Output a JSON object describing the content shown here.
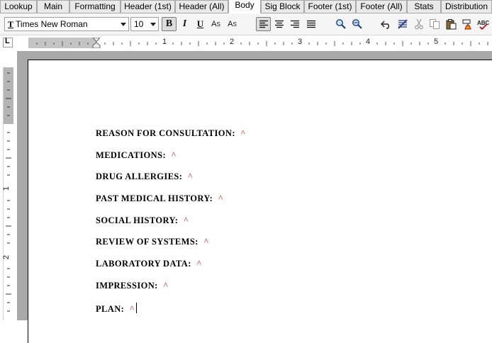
{
  "tabs": [
    {
      "label": "Lookup",
      "active": false
    },
    {
      "label": "Main",
      "active": false
    },
    {
      "label": "Formatting",
      "active": false
    },
    {
      "label": "Header (1st)",
      "active": false
    },
    {
      "label": "Header (All)",
      "active": false
    },
    {
      "label": "Body",
      "active": true
    },
    {
      "label": "Sig Block",
      "active": false
    },
    {
      "label": "Footer (1st)",
      "active": false
    },
    {
      "label": "Footer (All)",
      "active": false
    },
    {
      "label": "Stats",
      "active": false
    },
    {
      "label": "Distribution",
      "active": false
    }
  ],
  "toolbar": {
    "font_icon": "T",
    "font_name": "Times New Roman",
    "font_size": "10",
    "bold_label": "B",
    "italic_label": "I",
    "underline_label": "U",
    "superscript_base": "A",
    "superscript_mark": "S",
    "subscript_base": "A",
    "subscript_mark": "S",
    "icons": [
      "align-left-icon",
      "align-center-icon",
      "align-right-icon",
      "justify-icon",
      "zoom-in-icon",
      "zoom-out-icon",
      "undo-icon",
      "clear-format-icon",
      "cut-icon",
      "copy-icon",
      "paste-icon",
      "format-painter-icon",
      "spell-check-icon"
    ]
  },
  "ruler": {
    "corner_label": "L",
    "h_numbers": [
      "1",
      "2",
      "3",
      "4",
      "5"
    ],
    "v_numbers": [
      "1",
      "2"
    ]
  },
  "document": {
    "lines": [
      {
        "label": "REASON FOR CONSULTATION:",
        "marker": "^"
      },
      {
        "label": "MEDICATIONS:",
        "marker": "^"
      },
      {
        "label": "DRUG ALLERGIES:",
        "marker": "^"
      },
      {
        "label": "PAST MEDICAL HISTORY:",
        "marker": "^"
      },
      {
        "label": "SOCIAL HISTORY:",
        "marker": "^"
      },
      {
        "label": "REVIEW OF SYSTEMS:",
        "marker": "^"
      },
      {
        "label": "LABORATORY DATA:",
        "marker": "^"
      },
      {
        "label": "IMPRESSION:",
        "marker": "^"
      },
      {
        "label": "PLAN:",
        "marker": "^"
      }
    ]
  },
  "colors": {
    "marker": "#e00000",
    "ruler_gray": "#c4c4c4",
    "doc_background": "#a8a8a8"
  }
}
